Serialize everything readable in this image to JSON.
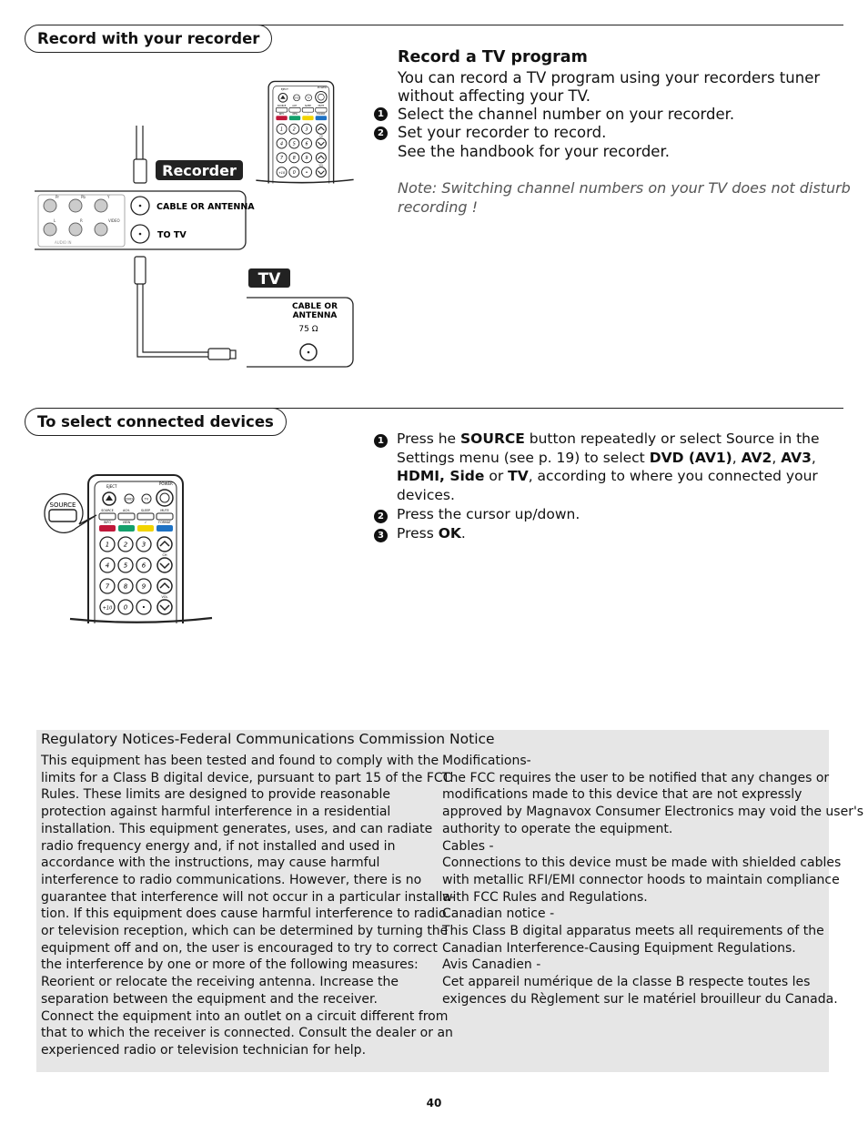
{
  "section1": {
    "heading": "Record with your recorder",
    "title": "Record a TV program",
    "intro": [
      "You can record a TV program using your recorders tuner",
      "without affecting your TV."
    ],
    "steps": [
      {
        "num": "1",
        "text": "Select the channel number on your recorder."
      },
      {
        "num": "2",
        "text": "Set your recorder to record."
      }
    ],
    "step_extra": "See the handbook for your recorder.",
    "note": [
      "Note: Switching channel numbers on your TV does not disturb",
      "recording !"
    ],
    "diagram": {
      "recorder_label": "Recorder",
      "tv_label": "TV",
      "cable_or_antenna": "CABLE OR ANTENNA",
      "to_tv": "TO TV",
      "tv_cable_line1": "CABLE OR",
      "tv_cable_line2": "ANTENNA",
      "ohm": "75 Ω",
      "jack_labels": [
        "Pr",
        "Pb",
        "Y",
        "L",
        "R",
        "VIDEO"
      ],
      "audio_in": "AUDIO IN"
    }
  },
  "section2": {
    "heading": "To select connected devices",
    "steps": [
      {
        "num": "1",
        "lines": [
          [
            {
              "t": "Press he "
            },
            {
              "t": "SOURCE",
              "b": true
            },
            {
              "t": " button repeatedly or select Source in the"
            }
          ],
          [
            {
              "t": "Settings menu (see p. 19) to select "
            },
            {
              "t": "DVD (AV1)",
              "b": true
            },
            {
              "t": ", "
            },
            {
              "t": "AV2",
              "b": true
            },
            {
              "t": ", "
            },
            {
              "t": "AV3",
              "b": true
            },
            {
              "t": ","
            }
          ],
          [
            {
              "t": "HDMI, Side",
              "b": true
            },
            {
              "t": " or "
            },
            {
              "t": "TV",
              "b": true
            },
            {
              "t": ", according to where you connected your"
            }
          ],
          [
            {
              "t": "devices."
            }
          ]
        ]
      },
      {
        "num": "2",
        "lines": [
          [
            {
              "t": "Press the cursor up/down."
            }
          ]
        ]
      },
      {
        "num": "3",
        "lines": [
          [
            {
              "t": "Press "
            },
            {
              "t": "OK",
              "b": true
            },
            {
              "t": "."
            }
          ]
        ]
      }
    ],
    "callout_label": "SOURCE"
  },
  "remote": {
    "top_labels": [
      "EJECT",
      "POWER"
    ],
    "row_labels": [
      "SOURCE",
      "ACH.",
      "SLEEP",
      "MUTE"
    ],
    "color_labels": [
      "INFO",
      "VIEW",
      "✓",
      "FORMAT"
    ],
    "keys": [
      "1",
      "2",
      "3",
      "4",
      "5",
      "6",
      "7",
      "8",
      "9",
      "+10",
      "0",
      "•"
    ],
    "small_keys": [
      "DVD",
      "TV"
    ],
    "ch": "CH",
    "vol": "VOL",
    "colors": [
      "#c0183a",
      "#14a06c",
      "#f2d400",
      "#1e72c4"
    ]
  },
  "regulatory": {
    "title": "Regulatory Notices-Federal Communications Commission Notice",
    "left": [
      "This equipment has been tested and found to comply with the",
      "limits for a Class B digital device, pursuant to part 15 of the FCC",
      "Rules. These limits are designed to provide reasonable",
      "protection against harmful interference in a residential",
      "installation. This equipment generates, uses, and can radiate",
      "radio frequency energy and, if not installed and used in",
      "accordance with the instructions, may cause harmful",
      "interference to radio communications. However, there is no",
      "guarantee that interference will not occur in a particular installa-",
      "tion. If this equipment does cause harmful interference to radio",
      "or television reception, which can be determined by turning the",
      "equipment off and on, the user is encouraged to try to correct",
      "the interference by one or more of the following measures:",
      "Reorient or relocate the receiving antenna. Increase the",
      "separation between the equipment and the receiver.",
      "Connect the equipment into an outlet on a circuit different from",
      "that to which the receiver is connected. Consult the dealer or an",
      "experienced radio or television technician for help."
    ],
    "right": [
      "Modifications-",
      "The FCC requires the user to be notified that any changes or",
      "modifications made to this device that are not expressly",
      "approved by Magnavox Consumer Electronics may void the user's",
      "authority to operate the equipment.",
      "Cables -",
      "Connections to this device must be made with shielded cables",
      "with metallic RFI/EMI connector hoods to maintain compliance",
      "with FCC Rules and Regulations.",
      "Canadian notice -",
      "This Class B digital apparatus meets all requirements of the",
      "Canadian Interference-Causing Equipment Regulations.",
      "Avis Canadien -",
      "Cet appareil numérique de la classe B respecte toutes les",
      "exigences du Règlement sur le matériel brouilleur du Canada."
    ]
  },
  "page_number": "40"
}
